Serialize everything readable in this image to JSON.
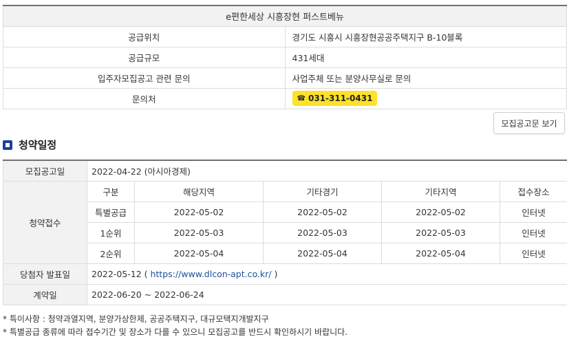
{
  "project": {
    "title": "e편한세상 시흥장현 퍼스트베뉴",
    "rows": [
      {
        "label": "공급위치",
        "value": "경기도 시흥시 시흥장현공공주택지구 B-10블록"
      },
      {
        "label": "공급규모",
        "value": "431세대"
      },
      {
        "label": "입주자모집공고 관련 문의",
        "value": "사업주체 또는 분양사무실로 문의"
      },
      {
        "label": "문의처",
        "value": "031-311-0431"
      }
    ],
    "phone_icon": "phone-icon",
    "colors": {
      "badge": "#fde12a",
      "accent": "#1c3f9c",
      "link": "#1a4f9c"
    }
  },
  "notice_button": "모집공고문 보기",
  "schedule": {
    "section_title": "청약일정",
    "notice_date_label": "모집공고일",
    "notice_date_value": "2022-04-22 (아시아경제)",
    "receipt_label": "청약접수",
    "columns": [
      "구분",
      "해당지역",
      "기타경기",
      "기타지역",
      "접수장소"
    ],
    "rows": [
      [
        "특별공급",
        "2022-05-02",
        "2022-05-02",
        "2022-05-02",
        "인터넷"
      ],
      [
        "1순위",
        "2022-05-03",
        "2022-05-03",
        "2022-05-03",
        "인터넷"
      ],
      [
        "2순위",
        "2022-05-04",
        "2022-05-04",
        "2022-05-04",
        "인터넷"
      ]
    ],
    "winner_label": "당첨자 발표일",
    "winner_date": "2022-05-12",
    "winner_paren_open": " ( ",
    "winner_url": "https://www.dlcon-apt.co.kr/",
    "winner_paren_close": " )",
    "contract_label": "계약일",
    "contract_value": "2022-06-20 ~ 2022-06-24"
  },
  "footnotes": [
    "* 특이사항 : 청약과열지역, 분양가상한제, 공공주택지구, 대규모택지개발지구",
    "* 특별공급 종류에 따라 접수기간 및 장소가 다를 수 있으니 모집공고를 반드시 확인하시기 바랍니다."
  ]
}
